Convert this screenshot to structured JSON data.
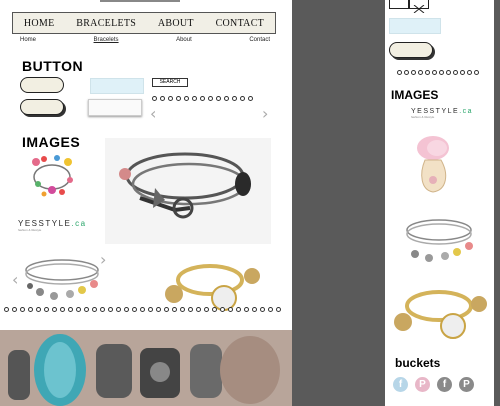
{
  "nav": {
    "items": [
      "HOME",
      "BRACELETS",
      "ABOUT",
      "CONTACT"
    ]
  },
  "subnav": {
    "items": [
      "Home",
      "Bracelets",
      "About",
      "Contact"
    ],
    "active_index": 1
  },
  "sections": {
    "button_heading": "BUTTON",
    "images_heading": "IMAGES",
    "images_heading_side": "IMAGES",
    "buckets_heading": "buckets"
  },
  "search": {
    "button_label": "SEARCH"
  },
  "carousel": {
    "prev_icon": "chevron-left-icon",
    "next_icon": "chevron-right-icon"
  },
  "logo": {
    "text_main": "YESSTYLE",
    "text_suffix": ".ca",
    "tagline": "fashion & lifestyle"
  },
  "social": [
    {
      "icon": "facebook-icon",
      "glyph": "f",
      "color": "#b7d6e8"
    },
    {
      "icon": "pinterest-icon",
      "glyph": "P",
      "color": "#e8b7c8"
    },
    {
      "icon": "facebook-icon",
      "glyph": "f",
      "color": "#8a8a8a"
    },
    {
      "icon": "pinterest-icon",
      "glyph": "P",
      "color": "#8a8a8a"
    }
  ],
  "colors": {
    "nav_bg": "#f1efe6",
    "input_blue": "#dff1f8",
    "pill_bg": "#f2efe2",
    "backdrop": "#5a5a5a"
  }
}
